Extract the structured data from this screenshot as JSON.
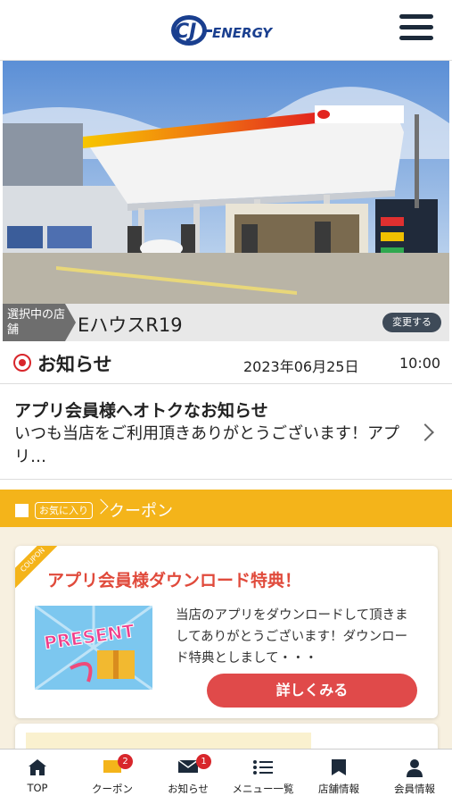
{
  "header": {
    "logo_text": "CJ-ENERGY",
    "menu_icon": "hamburger-menu-icon"
  },
  "store": {
    "tag_label": "選択中の店舗",
    "name": "EハウスR19",
    "change_label": "変更する"
  },
  "news": {
    "heading": "お知らせ",
    "date": "2023年06月25日",
    "time": "10:00",
    "item_title": "アプリ会員様へオトクなお知らせ",
    "item_body": "いつも当店をご利用頂きありがとうございます！アプリ…"
  },
  "coupon_section": {
    "fav_tag": "お気に入り",
    "label": "クーポン",
    "card": {
      "ribbon": "COUPON",
      "title": "アプリ会員様ダウンロード特典！",
      "image_text": "PRESENT",
      "description": "当店のアプリをダウンロードして頂きましてありがとうございます！ダウンロード特典としまして・・・",
      "button_label": "詳しくみる"
    }
  },
  "tabbar": {
    "tabs": [
      {
        "label": "TOP",
        "icon": "home-icon"
      },
      {
        "label": "クーポン",
        "icon": "ticket-icon",
        "badge": "2"
      },
      {
        "label": "お知らせ",
        "icon": "mail-icon",
        "badge": "1"
      },
      {
        "label": "メニュー一覧",
        "icon": "list-icon"
      },
      {
        "label": "店舗情報",
        "icon": "store-icon"
      },
      {
        "label": "会員情報",
        "icon": "user-icon"
      }
    ]
  },
  "colors": {
    "accent_yellow": "#f4b41a",
    "accent_red": "#e04a4a",
    "navy": "#1c2a3a"
  }
}
